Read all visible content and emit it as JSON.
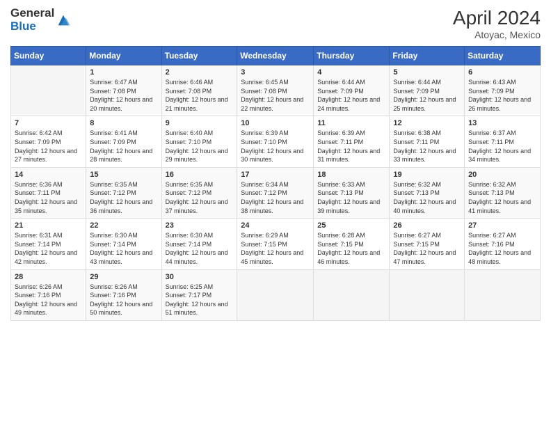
{
  "logo": {
    "general": "General",
    "blue": "Blue"
  },
  "title": {
    "month_year": "April 2024",
    "location": "Atoyac, Mexico"
  },
  "weekdays": [
    "Sunday",
    "Monday",
    "Tuesday",
    "Wednesday",
    "Thursday",
    "Friday",
    "Saturday"
  ],
  "weeks": [
    [
      {
        "day": "",
        "sunrise": "",
        "sunset": "",
        "daylight": ""
      },
      {
        "day": "1",
        "sunrise": "Sunrise: 6:47 AM",
        "sunset": "Sunset: 7:08 PM",
        "daylight": "Daylight: 12 hours and 20 minutes."
      },
      {
        "day": "2",
        "sunrise": "Sunrise: 6:46 AM",
        "sunset": "Sunset: 7:08 PM",
        "daylight": "Daylight: 12 hours and 21 minutes."
      },
      {
        "day": "3",
        "sunrise": "Sunrise: 6:45 AM",
        "sunset": "Sunset: 7:08 PM",
        "daylight": "Daylight: 12 hours and 22 minutes."
      },
      {
        "day": "4",
        "sunrise": "Sunrise: 6:44 AM",
        "sunset": "Sunset: 7:09 PM",
        "daylight": "Daylight: 12 hours and 24 minutes."
      },
      {
        "day": "5",
        "sunrise": "Sunrise: 6:44 AM",
        "sunset": "Sunset: 7:09 PM",
        "daylight": "Daylight: 12 hours and 25 minutes."
      },
      {
        "day": "6",
        "sunrise": "Sunrise: 6:43 AM",
        "sunset": "Sunset: 7:09 PM",
        "daylight": "Daylight: 12 hours and 26 minutes."
      }
    ],
    [
      {
        "day": "7",
        "sunrise": "Sunrise: 6:42 AM",
        "sunset": "Sunset: 7:09 PM",
        "daylight": "Daylight: 12 hours and 27 minutes."
      },
      {
        "day": "8",
        "sunrise": "Sunrise: 6:41 AM",
        "sunset": "Sunset: 7:09 PM",
        "daylight": "Daylight: 12 hours and 28 minutes."
      },
      {
        "day": "9",
        "sunrise": "Sunrise: 6:40 AM",
        "sunset": "Sunset: 7:10 PM",
        "daylight": "Daylight: 12 hours and 29 minutes."
      },
      {
        "day": "10",
        "sunrise": "Sunrise: 6:39 AM",
        "sunset": "Sunset: 7:10 PM",
        "daylight": "Daylight: 12 hours and 30 minutes."
      },
      {
        "day": "11",
        "sunrise": "Sunrise: 6:39 AM",
        "sunset": "Sunset: 7:11 PM",
        "daylight": "Daylight: 12 hours and 31 minutes."
      },
      {
        "day": "12",
        "sunrise": "Sunrise: 6:38 AM",
        "sunset": "Sunset: 7:11 PM",
        "daylight": "Daylight: 12 hours and 33 minutes."
      },
      {
        "day": "13",
        "sunrise": "Sunrise: 6:37 AM",
        "sunset": "Sunset: 7:11 PM",
        "daylight": "Daylight: 12 hours and 34 minutes."
      }
    ],
    [
      {
        "day": "14",
        "sunrise": "Sunrise: 6:36 AM",
        "sunset": "Sunset: 7:11 PM",
        "daylight": "Daylight: 12 hours and 35 minutes."
      },
      {
        "day": "15",
        "sunrise": "Sunrise: 6:35 AM",
        "sunset": "Sunset: 7:12 PM",
        "daylight": "Daylight: 12 hours and 36 minutes."
      },
      {
        "day": "16",
        "sunrise": "Sunrise: 6:35 AM",
        "sunset": "Sunset: 7:12 PM",
        "daylight": "Daylight: 12 hours and 37 minutes."
      },
      {
        "day": "17",
        "sunrise": "Sunrise: 6:34 AM",
        "sunset": "Sunset: 7:12 PM",
        "daylight": "Daylight: 12 hours and 38 minutes."
      },
      {
        "day": "18",
        "sunrise": "Sunrise: 6:33 AM",
        "sunset": "Sunset: 7:13 PM",
        "daylight": "Daylight: 12 hours and 39 minutes."
      },
      {
        "day": "19",
        "sunrise": "Sunrise: 6:32 AM",
        "sunset": "Sunset: 7:13 PM",
        "daylight": "Daylight: 12 hours and 40 minutes."
      },
      {
        "day": "20",
        "sunrise": "Sunrise: 6:32 AM",
        "sunset": "Sunset: 7:13 PM",
        "daylight": "Daylight: 12 hours and 41 minutes."
      }
    ],
    [
      {
        "day": "21",
        "sunrise": "Sunrise: 6:31 AM",
        "sunset": "Sunset: 7:14 PM",
        "daylight": "Daylight: 12 hours and 42 minutes."
      },
      {
        "day": "22",
        "sunrise": "Sunrise: 6:30 AM",
        "sunset": "Sunset: 7:14 PM",
        "daylight": "Daylight: 12 hours and 43 minutes."
      },
      {
        "day": "23",
        "sunrise": "Sunrise: 6:30 AM",
        "sunset": "Sunset: 7:14 PM",
        "daylight": "Daylight: 12 hours and 44 minutes."
      },
      {
        "day": "24",
        "sunrise": "Sunrise: 6:29 AM",
        "sunset": "Sunset: 7:15 PM",
        "daylight": "Daylight: 12 hours and 45 minutes."
      },
      {
        "day": "25",
        "sunrise": "Sunrise: 6:28 AM",
        "sunset": "Sunset: 7:15 PM",
        "daylight": "Daylight: 12 hours and 46 minutes."
      },
      {
        "day": "26",
        "sunrise": "Sunrise: 6:27 AM",
        "sunset": "Sunset: 7:15 PM",
        "daylight": "Daylight: 12 hours and 47 minutes."
      },
      {
        "day": "27",
        "sunrise": "Sunrise: 6:27 AM",
        "sunset": "Sunset: 7:16 PM",
        "daylight": "Daylight: 12 hours and 48 minutes."
      }
    ],
    [
      {
        "day": "28",
        "sunrise": "Sunrise: 6:26 AM",
        "sunset": "Sunset: 7:16 PM",
        "daylight": "Daylight: 12 hours and 49 minutes."
      },
      {
        "day": "29",
        "sunrise": "Sunrise: 6:26 AM",
        "sunset": "Sunset: 7:16 PM",
        "daylight": "Daylight: 12 hours and 50 minutes."
      },
      {
        "day": "30",
        "sunrise": "Sunrise: 6:25 AM",
        "sunset": "Sunset: 7:17 PM",
        "daylight": "Daylight: 12 hours and 51 minutes."
      },
      {
        "day": "",
        "sunrise": "",
        "sunset": "",
        "daylight": ""
      },
      {
        "day": "",
        "sunrise": "",
        "sunset": "",
        "daylight": ""
      },
      {
        "day": "",
        "sunrise": "",
        "sunset": "",
        "daylight": ""
      },
      {
        "day": "",
        "sunrise": "",
        "sunset": "",
        "daylight": ""
      }
    ]
  ]
}
